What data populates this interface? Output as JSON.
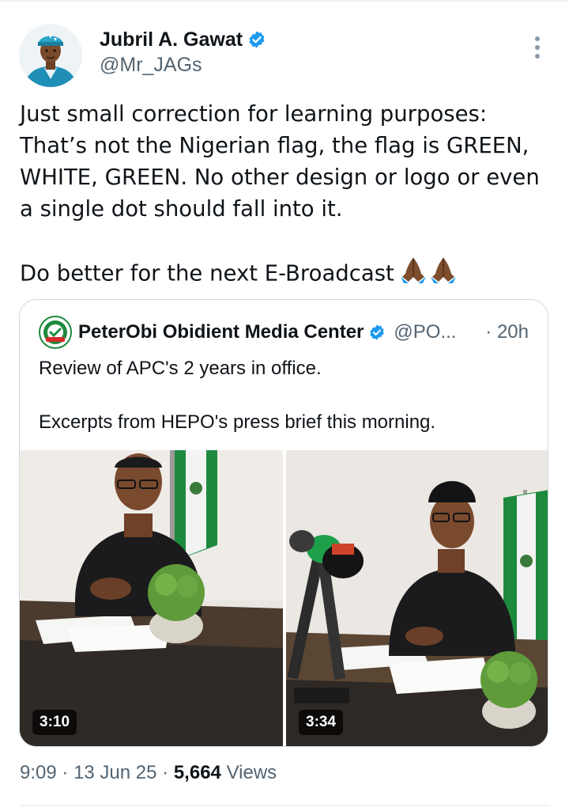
{
  "author": {
    "name": "Jubril A. Gawat",
    "handle": "@Mr_JAGs",
    "verified": true
  },
  "tweet": {
    "paragraph_1_line_1": "Just small correction for learning purposes:",
    "paragraph_1_line_2": "That’s not the Nigerian flag, the flag is GREEN,",
    "paragraph_1_line_3": "WHITE, GREEN. No other design or logo or even",
    "paragraph_1_line_4": "a single dot should fall into it.",
    "paragraph_2": "Do better for the next E-Broadcast",
    "emoji": "folded-hands-medium-dark-skin-tone x2"
  },
  "quoted": {
    "name": "PeterObi Obidient Media Center",
    "handle": "@PO...",
    "time": "· 20h",
    "line_1": "Review of APC's 2 years in office.",
    "line_2": "Excerpts from HEPO's press brief this morning.",
    "avatar_text": "OBIDIENT",
    "media": [
      {
        "duration": "3:10"
      },
      {
        "duration": "3:34"
      }
    ]
  },
  "meta": {
    "time": "9:09",
    "date": "13 Jun 25",
    "views_count": "5,664",
    "views_label": "Views"
  },
  "colors": {
    "text_primary": "#0f1419",
    "text_secondary": "#536471",
    "verified_blue": "#1d9bf0",
    "border": "#cfd9de",
    "flag_green": "#1e8a3e"
  }
}
